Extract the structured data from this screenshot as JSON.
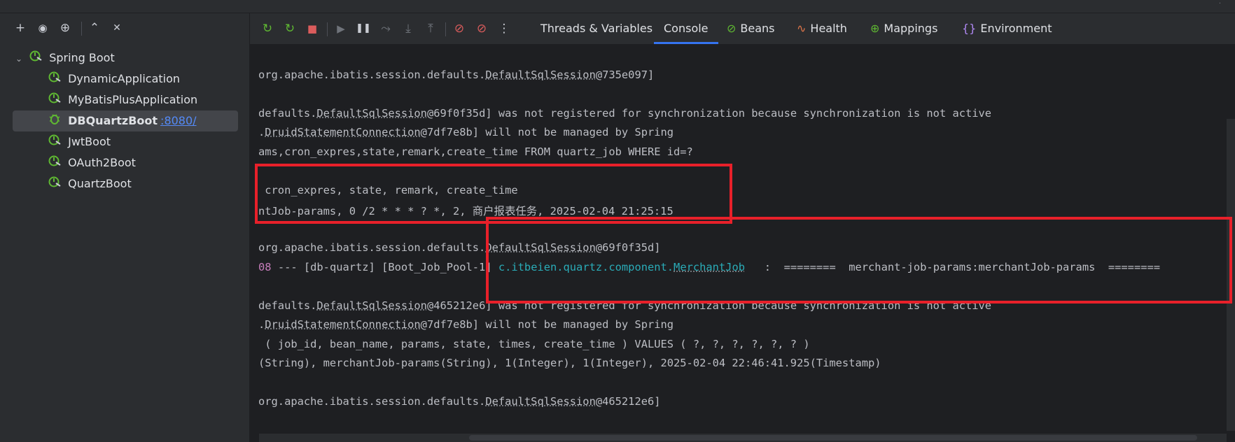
{
  "left_toolbar": {
    "icons": [
      "add-icon",
      "eye-icon",
      "new-tab-icon",
      "expand-all-icon",
      "collapse-all-icon"
    ],
    "glyphs": [
      "+",
      "◉",
      "⊕",
      "⌃",
      "✕"
    ]
  },
  "tree": {
    "root": "Spring Boot",
    "items": [
      {
        "label": "DynamicApplication",
        "port": ""
      },
      {
        "label": "MyBatisPlusApplication",
        "port": ""
      },
      {
        "label": "DBQuartzBoot",
        "port": ":8080/"
      },
      {
        "label": "JwtBoot",
        "port": ""
      },
      {
        "label": "OAuth2Boot",
        "port": ""
      },
      {
        "label": "QuartzBoot",
        "port": ""
      }
    ]
  },
  "debug_toolbar": {
    "glyphs": [
      "↻",
      "↻",
      "■",
      "▶",
      "❚❚",
      "⤳",
      "⤓",
      "⤒",
      "⊘",
      "⊘",
      "⋮"
    ]
  },
  "tabs": [
    {
      "label": "Threads & Variables",
      "icon": ""
    },
    {
      "label": "Console",
      "icon": ""
    },
    {
      "label": "Beans",
      "icon": "⊘"
    },
    {
      "label": "Health",
      "icon": "∿"
    },
    {
      "label": "Mappings",
      "icon": "⊕"
    },
    {
      "label": "Environment",
      "icon": "{}"
    }
  ],
  "console_lines": {
    "l1a": "org.apache.ibatis.session.defaults.",
    "l1b": "DefaultSqlSession",
    "l1c": "@735e097]",
    "l2a": "defaults.",
    "l2b": "DefaultSqlSession",
    "l2c": "@69f0f35d] was not registered for synchronization because synchronization is not active",
    "l3a": ".",
    "l3b": "DruidStatementConnection",
    "l3c": "@7df7e8b] will not be managed by Spring",
    "l4": "ams,cron_expres,state,remark,create_time FROM quartz_job WHERE id=?",
    "l5": " cron_expres, state, remark, create_time",
    "l6": "ntJob-params, 0 /2 * * * ? *, 2, 商户报表任务, 2025-02-04 21:25:15",
    "l7a": "org.apache.ibatis.session.defaults.",
    "l7b": "DefaultSqlSession",
    "l7c": "@69f0f35d]",
    "l8a": "08",
    "l8b": " --- [db-quartz] [Boot_Job_Pool-1] ",
    "l8c": "c.itbeien.quartz.component.",
    "l8d": "MerchantJob",
    "l8e": "   :  ========  merchant-job-params:merchantJob-params  ========",
    "l9a": "defaults.",
    "l9b": "DefaultSqlSession",
    "l9c": "@465212e6] was not registered for synchronization because synchronization is not active",
    "l10a": ".",
    "l10b": "DruidStatementConnection",
    "l10c": "@7df7e8b] will not be managed by Spring",
    "l11": " ( job_id, bean_name, params, state, times, create_time ) VALUES ( ?, ?, ?, ?, ?, ? )",
    "l12": "(String), merchantJob-params(String), 1(Integer), 1(Integer), 2025-02-04 22:46:41.925(Timestamp)",
    "l13a": "org.apache.ibatis.session.defaults.",
    "l13b": "DefaultSqlSession",
    "l13c": "@465212e6]"
  },
  "colors": {
    "accent": "#3574f0",
    "highlight_box": "#e8202a",
    "spring_green": "#5fb832",
    "class_link": "#2aacb8"
  }
}
